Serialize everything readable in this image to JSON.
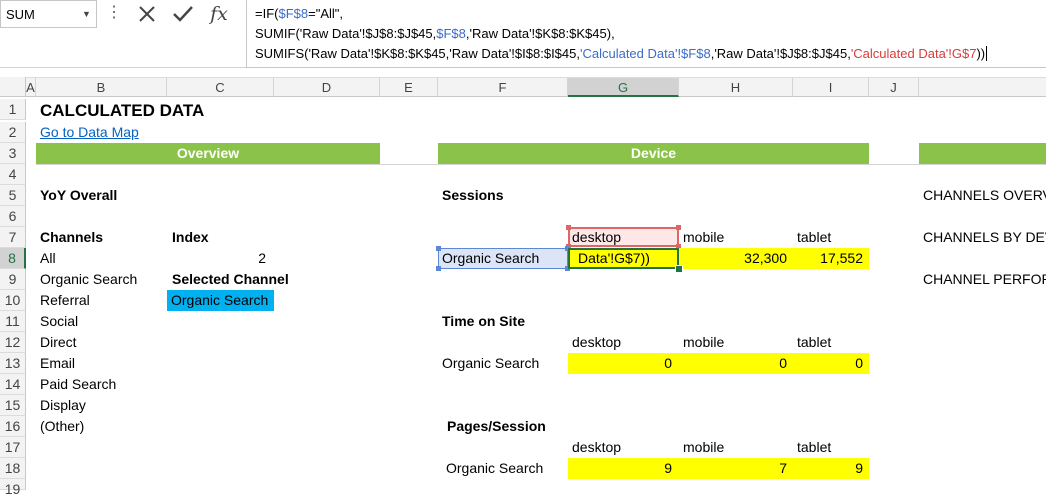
{
  "formula_bar": {
    "name_box": "SUM",
    "cancel_icon": "x-icon",
    "enter_icon": "check-icon",
    "function_icon": "fx-icon",
    "line1": {
      "a": "=IF(",
      "b": "$F$8",
      "c": "=\"All\","
    },
    "line2": {
      "a": "SUMIF('Raw Data'!$J$8:$J$45,",
      "b": "$F$8",
      "c": ",'Raw Data'!$K$8:$K$45),"
    },
    "line3": {
      "a": "SUMIFS('Raw Data'!$K$8:$K$45,'Raw Data'!$I$8:$I$45,",
      "b": "'Calculated Data'!$F$8",
      "c": ",'Raw Data'!$J$8:$J$45,",
      "d": "'Calculated Data'!G$7",
      "e": "))"
    }
  },
  "columns": [
    "A",
    "B",
    "C",
    "D",
    "E",
    "F",
    "G",
    "H",
    "I",
    "J"
  ],
  "rows": [
    "1",
    "2",
    "3",
    "4",
    "5",
    "6",
    "7",
    "8",
    "9",
    "10",
    "11",
    "12",
    "13",
    "14",
    "15",
    "16",
    "17",
    "18",
    "19"
  ],
  "sheet": {
    "title": "CALCULATED DATA",
    "link": "Go to Data Map",
    "overview_header": "Overview",
    "device_header": "Device",
    "yoy": "YoY Overall",
    "channels_header": "Channels",
    "channels": [
      "All",
      "Organic Search",
      "Referral",
      "Social",
      "Direct",
      "Email",
      "Paid Search",
      "Display",
      "(Other)"
    ],
    "index_label": "Index",
    "index_value": "2",
    "selected_channel_label": "Selected Channel",
    "selected_channel_value": "Organic Search",
    "sessions": {
      "title": "Sessions",
      "headers": [
        "desktop",
        "mobile",
        "tablet"
      ],
      "row_label": "Organic Search",
      "edit_text": "Data'!G$7))",
      "mobile": "32,300",
      "tablet": "17,552"
    },
    "time_on_site": {
      "title": "Time on Site",
      "headers": [
        "desktop",
        "mobile",
        "tablet"
      ],
      "row_label": "Organic Search",
      "values": [
        "0",
        "0",
        "0"
      ]
    },
    "pages_session": {
      "title": "Pages/Session",
      "headers": [
        "desktop",
        "mobile",
        "tablet"
      ],
      "row_label": "Organic Search",
      "values": [
        "9",
        "7",
        "9"
      ]
    },
    "right_labels": [
      "CHANNELS OVERVI",
      "CHANNELS BY DEV",
      "CHANNEL PERFORM"
    ]
  }
}
